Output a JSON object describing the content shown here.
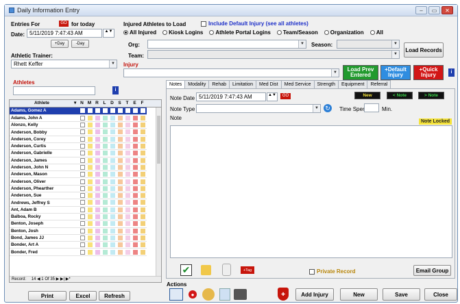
{
  "window": {
    "title": "Daily Information Entry",
    "btns": [
      "‒",
      "▭",
      "✕"
    ]
  },
  "entries": {
    "label": "Entries For",
    "today_badge": "GO",
    "for_today": "for today",
    "date_label": "Date:",
    "date_value": "5/11/2019  7:47:43 AM",
    "plus_day": "+Day",
    "minus_day": "-Day"
  },
  "trainer": {
    "label": "Athletic Trainer:",
    "value": "Rhett Keffer"
  },
  "injured": {
    "label": "Injured Athletes to Load",
    "include_default": "Include Default Injury (see all athletes)",
    "radios": [
      "All Injured",
      "Kiosk Logins",
      "Athlete Portal Logins",
      "Team/Season",
      "Organization",
      "All"
    ],
    "org_label": "Org:",
    "season_label": "Season:",
    "team_label": "Team:",
    "load_records": "Load Records",
    "injury_label": "Injury"
  },
  "quick_buttons": {
    "load_prev": "Load Prev Entered",
    "default_injury": "+Default Injury",
    "quick_injury": "+Quick Injury"
  },
  "athletes": {
    "label": "Athletes",
    "col_header": "Athlete",
    "col_flags": [
      "N",
      "M",
      "R",
      "L",
      "D",
      "S",
      "T",
      "E",
      "F"
    ],
    "names": [
      "Adams, Gomez A",
      "Adams, John A",
      "Alonzo, Kelly",
      "Anderson, Bobby",
      "Anderson, Corey",
      "Anderson, Curtis",
      "Anderson, Gabrielle",
      "Anderson, James",
      "Anderson, John N",
      "Anderson, Mason",
      "Anderson, Oliver",
      "Anderson, Phearther",
      "Anderson, Sue",
      "Andrews, Jeffrey S",
      "Ant, Adam B",
      "Balboa, Rocky",
      "Benton, Joseph",
      "Benton, Josh",
      "Bond, James JJ",
      "Bonder, Art A",
      "Bonder, Fred"
    ],
    "record_label": "Record:",
    "record_nav": "14  ◀  1 Of 35  ▶  ▶|  ▶*"
  },
  "tabs": [
    "Notes",
    "Modality",
    "Rehab",
    "Limitation",
    "Med Dist",
    "Med Service",
    "Strength",
    "Equipment",
    "Referral"
  ],
  "notes": {
    "date_label": "Note Date",
    "date_value": "5/11/2019  7:47:43 AM",
    "type_label": "Note Type",
    "time_spent": "Time Spent",
    "min": "Min.",
    "note_label": "Note",
    "note_locked": "Note Locked",
    "new_btn": "New",
    "note_btn1": "< Note",
    "note_btn2": "> Note",
    "private": "Private Record",
    "email_group": "Email Group"
  },
  "actions": {
    "label": "Actions",
    "add_injury": "Add Injury",
    "new": "New",
    "save": "Save",
    "close": "Close"
  },
  "left_bottom": {
    "print": "Print",
    "excel": "Excel",
    "refresh": "Refresh"
  },
  "colors": {
    "selected_row": "#1f3fae",
    "flag_colors": [
      "#2b56c0",
      "#f6d84e",
      "#e7a8e2",
      "#9be3c7",
      "#aee3ef",
      "#f5b57a",
      "#f0bde0",
      "#e85b5b",
      "#f0c14a"
    ]
  }
}
